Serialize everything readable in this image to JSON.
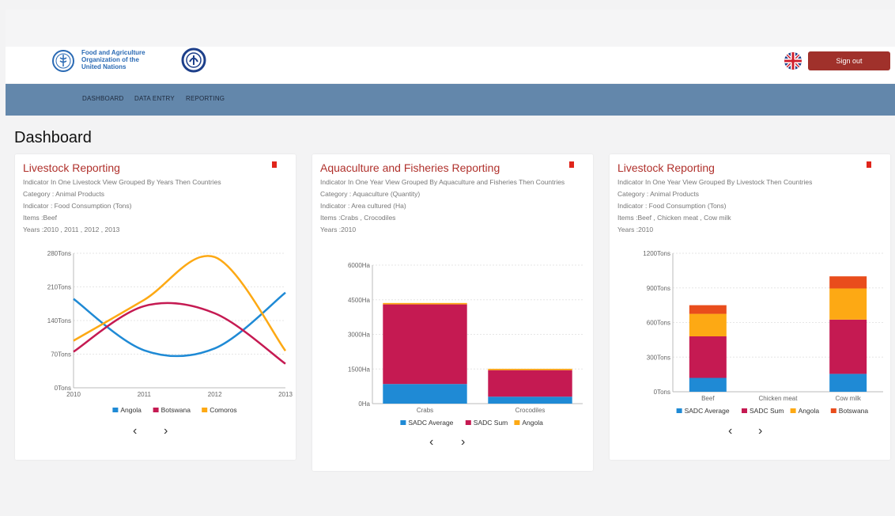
{
  "header": {
    "fao_text": [
      "Food and Agriculture",
      "Organization of the",
      "United Nations"
    ],
    "signout_label": "Sign out",
    "flag_icon": "uk-flag-icon"
  },
  "nav": {
    "items": [
      "DASHBOARD",
      "DATA ENTRY",
      "REPORTING"
    ]
  },
  "page": {
    "title": "Dashboard"
  },
  "colors": {
    "accent": "#b0312c",
    "navbar": "#6387ab",
    "blue": "#1f8ad5",
    "crimson": "#c51a52",
    "orange": "#fda914",
    "redorange": "#e94d1c"
  },
  "cards": [
    {
      "title": "Livestock Reporting",
      "meta": [
        "Indicator In One Livestock View Grouped By Years Then Countries",
        "Category : Animal Products",
        "Indicator : Food Consumption (Tons)",
        "Items :Beef",
        "Years :2010 , 2011 , 2012 , 2013"
      ]
    },
    {
      "title": "Aquaculture and Fisheries Reporting",
      "meta": [
        "Indicator In One Year View Grouped By Aquaculture and Fisheries Then Countries",
        "Category : Aquaculture (Quantity)",
        "Indicator : Area cultured (Ha)",
        "Items :Crabs , Crocodiles",
        "Years :2010"
      ]
    },
    {
      "title": "Livestock Reporting",
      "meta": [
        "Indicator In One Year View Grouped By Livestock Then Countries",
        "Category : Animal Products",
        "Indicator : Food Consumption (Tons)",
        "Items :Beef , Chicken meat , Cow milk",
        "Years :2010"
      ]
    }
  ],
  "pager": {
    "prev": "‹",
    "next": "›"
  },
  "chart_data": [
    {
      "type": "line",
      "x": [
        "2010",
        "2011",
        "2012",
        "2013"
      ],
      "ylim": [
        0,
        280
      ],
      "yticks": [
        "0Tons",
        "70Tons",
        "140Tons",
        "210Tons",
        "280Tons"
      ],
      "series": [
        {
          "name": "Angola",
          "color": "#1f8ad5",
          "values": [
            185,
            78,
            82,
            198
          ]
        },
        {
          "name": "Botswana",
          "color": "#c51a52",
          "values": [
            75,
            170,
            155,
            50
          ]
        },
        {
          "name": "Comoros",
          "color": "#fda914",
          "values": [
            98,
            183,
            272,
            77
          ]
        }
      ],
      "legend": "bottom"
    },
    {
      "type": "bar",
      "stacked": true,
      "categories": [
        "Crabs",
        "Crocodiles"
      ],
      "ylim": [
        0,
        6000
      ],
      "yticks": [
        "0Ha",
        "1500Ha",
        "3000Ha",
        "4500Ha",
        "6000Ha"
      ],
      "series": [
        {
          "name": "SADC Average",
          "color": "#1f8ad5",
          "values": [
            850,
            300
          ]
        },
        {
          "name": "SADC Sum",
          "color": "#c51a52",
          "values": [
            3450,
            1150
          ]
        },
        {
          "name": "Angola",
          "color": "#fda914",
          "values": [
            60,
            60
          ]
        }
      ],
      "legend": "bottom"
    },
    {
      "type": "bar",
      "stacked": true,
      "categories": [
        "Beef",
        "Chicken meat",
        "Cow milk"
      ],
      "ylim": [
        0,
        1200
      ],
      "yticks": [
        "0Tons",
        "300Tons",
        "600Tons",
        "900Tons",
        "1200Tons"
      ],
      "series": [
        {
          "name": "SADC Average",
          "color": "#1f8ad5",
          "values": [
            120,
            0,
            155
          ]
        },
        {
          "name": "SADC Sum",
          "color": "#c51a52",
          "values": [
            360,
            0,
            470
          ]
        },
        {
          "name": "Angola",
          "color": "#fda914",
          "values": [
            195,
            0,
            270
          ]
        },
        {
          "name": "Botswana",
          "color": "#e94d1c",
          "values": [
            75,
            0,
            105
          ]
        }
      ],
      "legend": "bottom"
    }
  ]
}
